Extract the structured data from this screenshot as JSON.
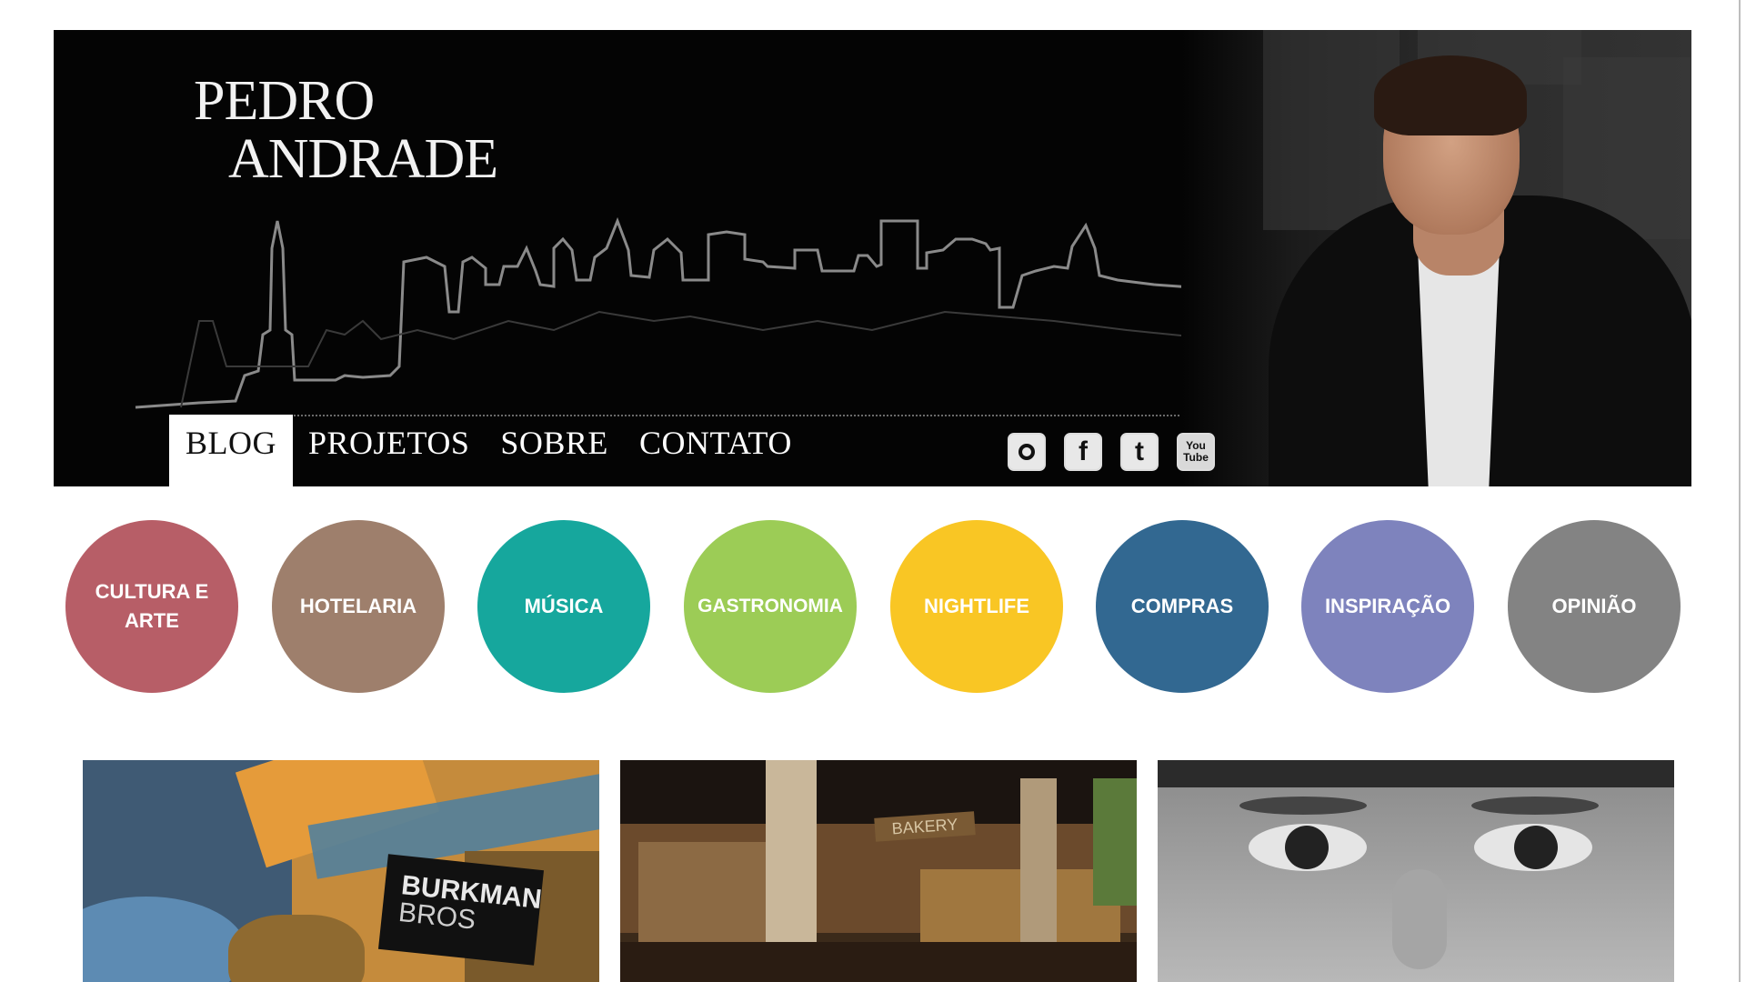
{
  "brand": {
    "line1": "PEDRO",
    "line2": "ANDRADE"
  },
  "nav": {
    "items": [
      {
        "label": "BLOG"
      },
      {
        "label": "PROJETOS"
      },
      {
        "label": "SOBRE"
      },
      {
        "label": "CONTATO"
      }
    ],
    "active": "BLOG"
  },
  "social": {
    "icons": [
      "instagram-icon",
      "facebook-icon",
      "twitter-icon",
      "youtube-icon"
    ],
    "facebook_glyph": "f",
    "twitter_glyph": "t",
    "youtube_line1": "You",
    "youtube_line2": "Tube"
  },
  "categories": [
    {
      "label": "CULTURA E ARTE",
      "color": "#b75e67"
    },
    {
      "label": "HOTELARIA",
      "color": "#9e7f6c"
    },
    {
      "label": "MÚSICA",
      "color": "#16a79d"
    },
    {
      "label": "GASTRONOMIA",
      "color": "#9ccc56"
    },
    {
      "label": "NIGHTLIFE",
      "color": "#f9c624"
    },
    {
      "label": "COMPRAS",
      "color": "#326891"
    },
    {
      "label": "INSPIRAÇÃO",
      "color": "#7e83bd"
    },
    {
      "label": "OPINIÃO",
      "color": "#838383"
    }
  ],
  "posts": [
    {
      "tag_line1": "BURKMAN",
      "tag_line2": "BROS"
    },
    {
      "sign": "BAKERY"
    },
    {}
  ]
}
